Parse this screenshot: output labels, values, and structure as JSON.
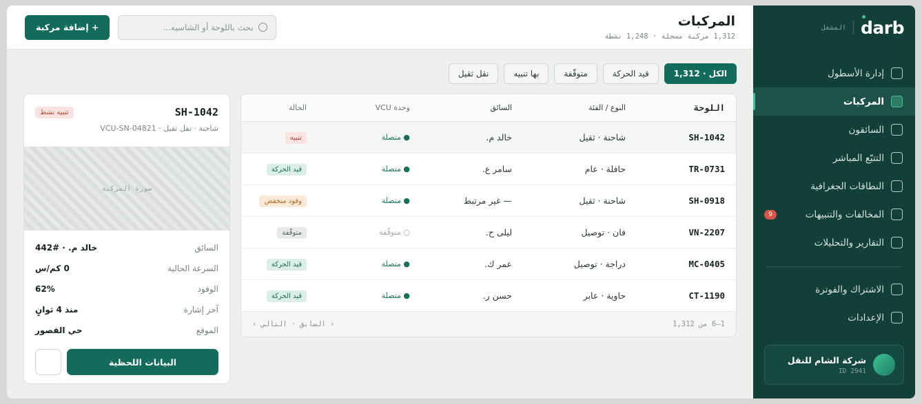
{
  "brand": {
    "logo": "darb",
    "role": "المشغل"
  },
  "sidebar": {
    "items": [
      {
        "label": "إدارة الأسطول"
      },
      {
        "label": "المركبات",
        "active": true
      },
      {
        "label": "السائقون"
      },
      {
        "label": "التتبّع المباشر"
      },
      {
        "label": "النطاقات الجغرافية"
      },
      {
        "label": "المخالفات والتنبيهات",
        "badge": "9"
      },
      {
        "label": "التقارير والتحليلات"
      }
    ],
    "bottom_items": [
      {
        "label": "الاشتراك والفوترة"
      },
      {
        "label": "الإعدادات"
      }
    ],
    "org": {
      "name": "شركة الشام للنقل",
      "id": "ID 2941"
    }
  },
  "header": {
    "title": "المركبات",
    "subtitle": "1,312 مركبة مسجلة · 1,248 نشطة",
    "search_placeholder": "بحث باللوحة أو الشاسيه...",
    "add_button": "+ إضافة مركبة"
  },
  "filters": [
    {
      "label": "الكل · 1,312",
      "active": true
    },
    {
      "label": "قيد الحركة"
    },
    {
      "label": "متوقّفة"
    },
    {
      "label": "بها تنبيه"
    },
    {
      "label": "نقل ثقيل"
    }
  ],
  "table": {
    "headers": {
      "plate": "اللوحة",
      "type": "النوع / الفئة",
      "driver": "السائق",
      "vcu": "وحدة VCU",
      "status": "الحالة"
    },
    "rows": [
      {
        "plate": "SH-1042",
        "type": "شاحنة · ثقيل",
        "driver": "خالد م.",
        "vcu": "● متصلة",
        "vcu_state": "on",
        "status": "تنبيه",
        "status_kind": "alert"
      },
      {
        "plate": "TR-0731",
        "type": "حافلة · عام",
        "driver": "سامر ع.",
        "vcu": "● متصلة",
        "vcu_state": "on",
        "status": "قيد الحركة",
        "status_kind": "moving"
      },
      {
        "plate": "SH-0918",
        "type": "شاحنة · ثقيل",
        "driver": "— غير مرتبط",
        "vcu": "● متصلة",
        "vcu_state": "on",
        "status": "وقود منخفض",
        "status_kind": "fuel"
      },
      {
        "plate": "VN-2207",
        "type": "فان · توصيل",
        "driver": "ليلى ح.",
        "vcu": "○ متوقّفة",
        "vcu_state": "off",
        "status": "متوقّفة",
        "status_kind": "stopped"
      },
      {
        "plate": "MC-0405",
        "type": "دراجة · توصيل",
        "driver": "عمر ك.",
        "vcu": "● متصلة",
        "vcu_state": "on",
        "status": "قيد الحركة",
        "status_kind": "moving"
      },
      {
        "plate": "CT-1190",
        "type": "حاوية · عابر",
        "driver": "حسن ر.",
        "vcu": "● متصلة",
        "vcu_state": "on",
        "status": "قيد الحركة",
        "status_kind": "moving"
      }
    ],
    "footer_count": "1–6 من 1,312",
    "prev": "‹ السابق",
    "next": "التالي ›"
  },
  "detail": {
    "plate": "SH-1042",
    "alert_badge": "تنبيه نشط",
    "meta": "شاحنة · نقل ثقيل · VCU-SN-04821",
    "image_placeholder": "صورة المركبة",
    "stats": [
      {
        "key": "السائق",
        "value": "خالد م. · #442"
      },
      {
        "key": "السرعة الحالية",
        "value": "0 كم/س"
      },
      {
        "key": "الوقود",
        "value": "62%"
      },
      {
        "key": "آخر إشارة",
        "value": "منذ 4 ثوانٍ"
      },
      {
        "key": "الموقع",
        "value": "حي القصور"
      }
    ],
    "live_button": "البيانات اللحظية"
  },
  "colors": {
    "sidebar_bg": "#123f38",
    "accent": "#136b5c",
    "active_marker": "#3cc497",
    "alert": "#b6463a"
  }
}
